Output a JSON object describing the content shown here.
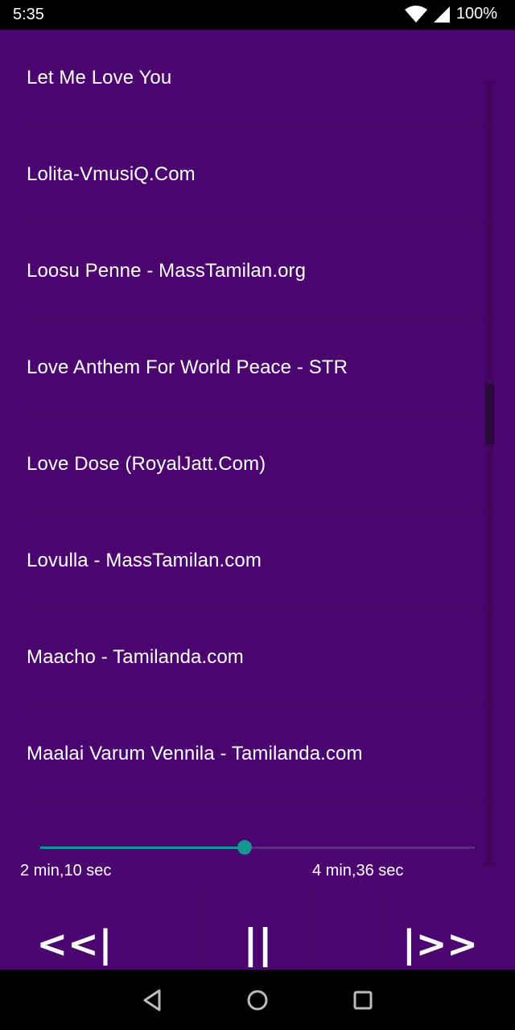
{
  "status_bar": {
    "time": "5:35",
    "battery": "100%"
  },
  "songs": [
    "Let Me Love You",
    "Lolita-VmusiQ.Com",
    "Loosu Penne - MassTamilan.org",
    "Love Anthem For World Peace - STR",
    "Love Dose (RoyalJatt.Com)",
    "Lovulla - MassTamilan.com",
    "Maacho - Tamilanda.com",
    "Maalai Varum Vennila - Tamilanda.com"
  ],
  "player": {
    "elapsed": "2 min,10 sec",
    "total": "4 min,36 sec",
    "progress_fraction": 0.47,
    "prev_label": "<<|",
    "pause_label": "||",
    "next_label": "|>>"
  },
  "colors": {
    "background": "#4a066e",
    "accent": "#16948e"
  },
  "icons": {
    "wifi": "wifi-icon",
    "signal": "cell-signal-icon",
    "battery": "battery-icon",
    "back": "back-triangle-icon",
    "home": "home-circle-icon",
    "recents": "recents-square-icon"
  }
}
